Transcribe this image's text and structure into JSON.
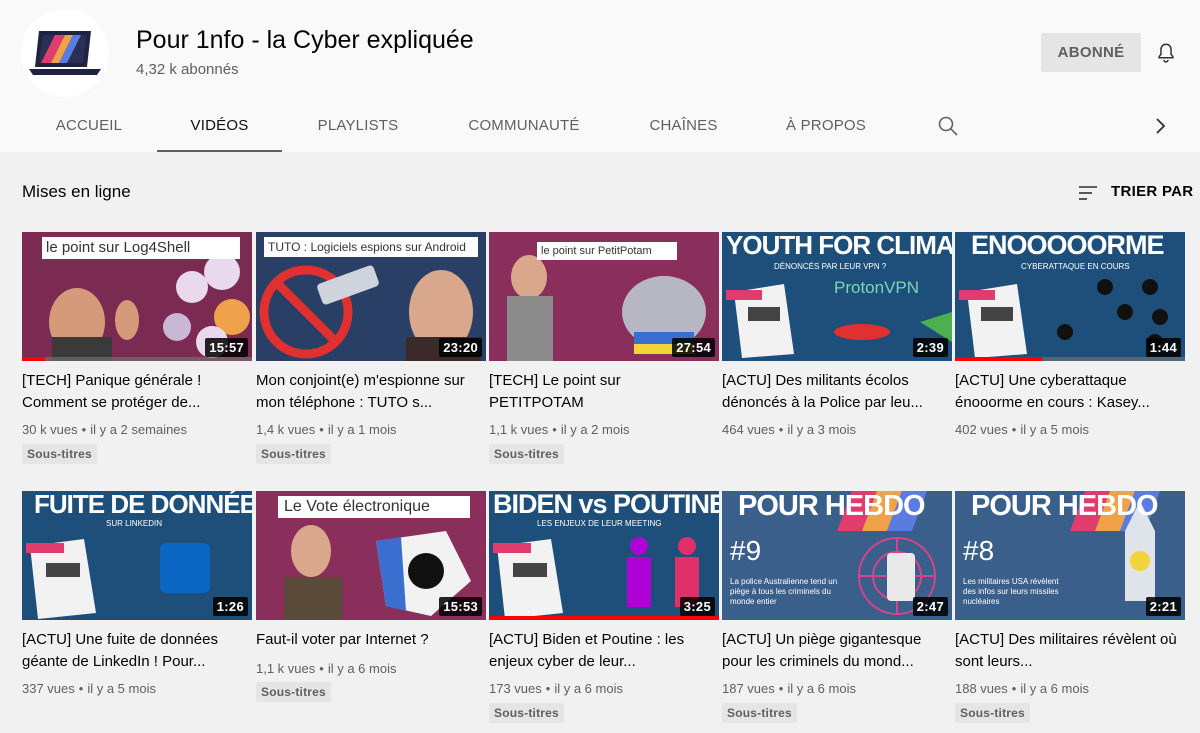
{
  "channel": {
    "title": "Pour 1nfo - la Cyber expliquée",
    "subscribers": "4,32 k abonnés",
    "subscribe_label": "ABONNÉ",
    "icons": {
      "bell": "bell-icon",
      "search": "search-icon",
      "next": "chevron-right-icon",
      "sort": "sort-icon"
    }
  },
  "tabs": [
    {
      "label": "ACCUEIL",
      "active": false
    },
    {
      "label": "VIDÉOS",
      "active": true
    },
    {
      "label": "PLAYLISTS",
      "active": false
    },
    {
      "label": "COMMUNAUTÉ",
      "active": false
    },
    {
      "label": "CHAÎNES",
      "active": false
    },
    {
      "label": "À PROPOS",
      "active": false
    }
  ],
  "section": {
    "title": "Mises en ligne",
    "sort_label": "TRIER PAR"
  },
  "colors": {
    "accent_red": "#ff0000",
    "thumb_purple": "#7b2a52",
    "thumb_blue": "#1d4f7a"
  },
  "videos": [
    {
      "title": "[TECH] Panique générale ! Comment se protéger de...",
      "duration": "15:57",
      "views": "30 k vues",
      "age": "il y a 2 semaines",
      "badge": "Sous-titres",
      "thumb_text": "le point sur Log4Shell",
      "progress": 0.1
    },
    {
      "title": "Mon conjoint(e) m'espionne sur mon téléphone : TUTO s...",
      "duration": "23:20",
      "views": "1,4 k vues",
      "age": "il y a 1 mois",
      "badge": "Sous-titres",
      "thumb_text": "TUTO : Logiciels espions sur Android",
      "progress": 0
    },
    {
      "title": "[TECH] Le point sur PETITPOTAM",
      "duration": "27:54",
      "views": "1,1 k vues",
      "age": "il y a 2 mois",
      "badge": "Sous-titres",
      "thumb_text": "le point sur PetitPotam",
      "progress": 0
    },
    {
      "title": "[ACTU] Des militants écolos dénoncés à la Police par leu...",
      "duration": "2:39",
      "views": "464 vues",
      "age": "il y a 3 mois",
      "badge": "",
      "thumb_text": "YOUTH FOR CLIMATE",
      "thumb_sub": "DÉNONCÉS PAR LEUR VPN ?",
      "thumb_extra": "ProtonVPN",
      "progress": 0
    },
    {
      "title": "[ACTU] Une cyberattaque énooorme en cours : Kasey...",
      "duration": "1:44",
      "views": "402 vues",
      "age": "il y a 5 mois",
      "badge": "",
      "thumb_text": "ENOOOOORME",
      "thumb_sub": "CYBERATTAQUE EN COURS",
      "progress": 0.38
    },
    {
      "title": "[ACTU] Une fuite de données géante de LinkedIn ! Pour...",
      "duration": "1:26",
      "views": "337 vues",
      "age": "il y a 5 mois",
      "badge": "",
      "thumb_text": "FUITE DE DONNÉES",
      "thumb_sub": "SUR LINKEDIN",
      "progress": 0
    },
    {
      "title": "Faut-il voter par Internet ?",
      "duration": "15:53",
      "views": "1,1 k vues",
      "age": "il y a 6 mois",
      "badge": "Sous-titres",
      "thumb_text": "Le Vote électronique",
      "progress": 0,
      "one_line": true
    },
    {
      "title": "[ACTU] Biden et Poutine : les enjeux cyber de leur...",
      "duration": "3:25",
      "views": "173 vues",
      "age": "il y a 6 mois",
      "badge": "Sous-titres",
      "thumb_text": "BIDEN vs POUTINE",
      "thumb_sub": "LES ENJEUX DE LEUR MEETING",
      "progress": 1
    },
    {
      "title": "[ACTU] Un piège gigantesque pour les criminels du mond...",
      "duration": "2:47",
      "views": "187 vues",
      "age": "il y a 6 mois",
      "badge": "Sous-titres",
      "thumb_text": "POUR HEBDO",
      "thumb_num": "#9",
      "thumb_sub": "La police Australienne tend un piège à tous les criminels du monde entier",
      "progress": 0
    },
    {
      "title": "[ACTU] Des militaires révèlent où sont leurs...",
      "duration": "2:21",
      "views": "188 vues",
      "age": "il y a 6 mois",
      "badge": "Sous-titres",
      "thumb_text": "POUR HEBDO",
      "thumb_num": "#8",
      "thumb_sub": "Les militaires USA révèlent des infos sur leurs missiles nucléaires",
      "progress": 0
    }
  ]
}
